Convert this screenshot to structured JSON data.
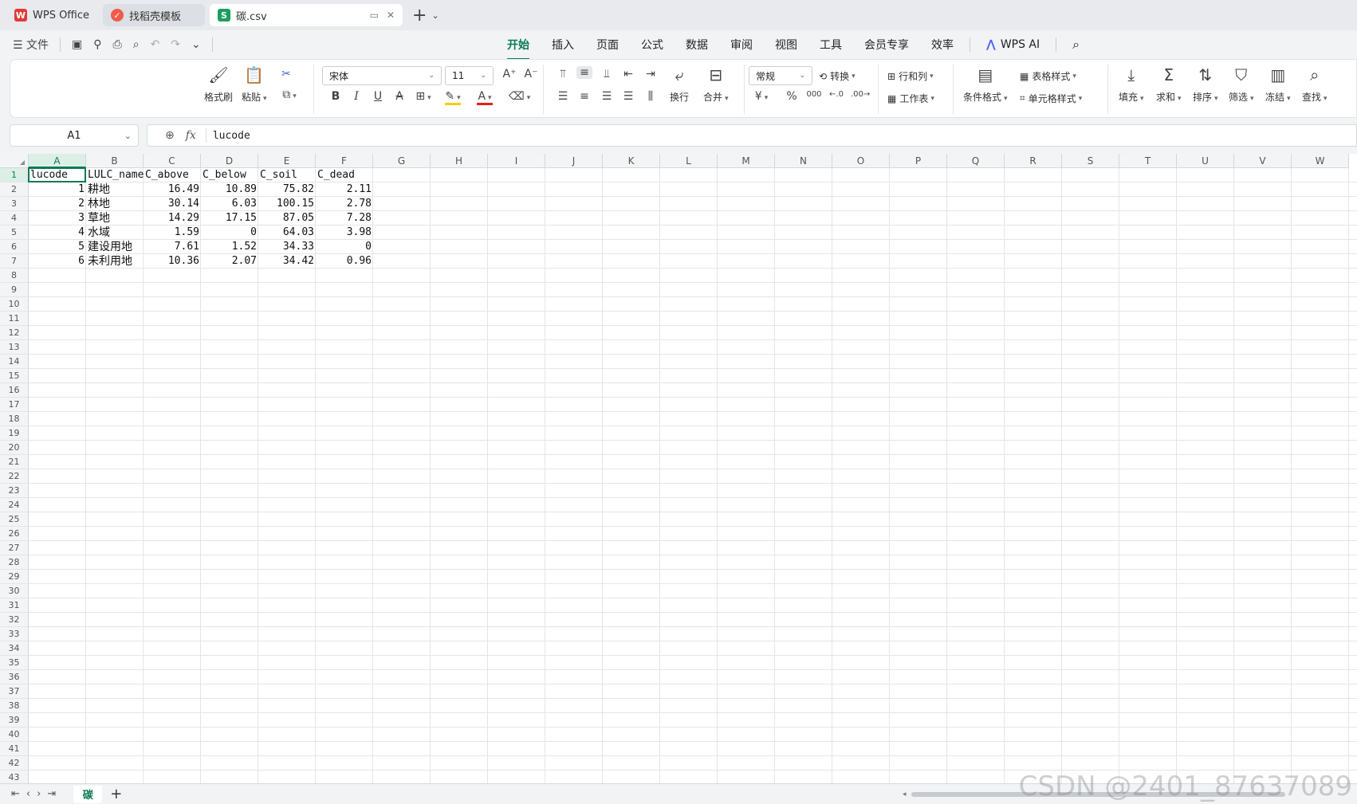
{
  "tabs": [
    {
      "label": "WPS Office",
      "icon": "wps-logo-icon"
    },
    {
      "label": "找稻壳模板",
      "icon": "docer-icon"
    },
    {
      "label": "碳.csv",
      "icon": "spreadsheet-s-icon",
      "active": true
    }
  ],
  "quickbar": {
    "file_label": "文件"
  },
  "menus": [
    "开始",
    "插入",
    "页面",
    "公式",
    "数据",
    "审阅",
    "视图",
    "工具",
    "会员专享",
    "效率"
  ],
  "menu_active": "开始",
  "wps_ai_label": "WPS AI",
  "ribbon": {
    "format_painter": "格式刷",
    "paste": "粘贴",
    "font_name": "宋体",
    "font_size": "11",
    "wrap": "换行",
    "merge": "合并",
    "number_format": "常规",
    "convert": "转换",
    "row_col": "行和列",
    "worksheet": "工作表",
    "cond_format": "条件格式",
    "table_style": "表格样式",
    "cell_style": "单元格样式",
    "fill": "填充",
    "sum": "求和",
    "sort": "排序",
    "filter": "筛选",
    "freeze": "冻结",
    "find": "查找",
    "currency_symbol": "¥",
    "percent_symbol": "%",
    "thousands_symbol": "000"
  },
  "formula_bar": {
    "name_box": "A1",
    "fx_label": "fx",
    "value": "lucode"
  },
  "columns": [
    "A",
    "B",
    "C",
    "D",
    "E",
    "F",
    "G",
    "H",
    "I",
    "J",
    "K",
    "L",
    "M",
    "N",
    "O",
    "P",
    "Q",
    "R",
    "S",
    "T",
    "U",
    "V",
    "W"
  ],
  "rows": [
    "1",
    "2",
    "3",
    "4",
    "5",
    "6",
    "7",
    "8",
    "9",
    "10",
    "11",
    "12",
    "13",
    "14",
    "15",
    "16",
    "17",
    "18",
    "19",
    "20",
    "21",
    "22",
    "23",
    "24",
    "25",
    "26",
    "27",
    "28",
    "29",
    "30",
    "31",
    "32",
    "33",
    "34",
    "35",
    "36",
    "37",
    "38",
    "39",
    "40",
    "41",
    "42",
    "43"
  ],
  "sheet": {
    "header": [
      "lucode",
      "LULC_name",
      "C_above",
      "C_below",
      "C_soil",
      "C_dead"
    ],
    "data": [
      [
        "1",
        "耕地",
        "16.49",
        "10.89",
        "75.82",
        "2.11"
      ],
      [
        "2",
        "林地",
        "30.14",
        "6.03",
        "100.15",
        "2.78"
      ],
      [
        "3",
        "草地",
        "14.29",
        "17.15",
        "87.05",
        "7.28"
      ],
      [
        "4",
        "水域",
        "1.59",
        "0",
        "64.03",
        "3.98"
      ],
      [
        "5",
        "建设用地",
        "7.61",
        "1.52",
        "34.33",
        "0"
      ],
      [
        "6",
        "未利用地",
        "10.36",
        "2.07",
        "34.42",
        "0.96"
      ]
    ]
  },
  "sheet_tabs": [
    "碳"
  ],
  "watermark": "CSDN @2401_87637089",
  "colors": {
    "accent": "#0e7a54"
  }
}
